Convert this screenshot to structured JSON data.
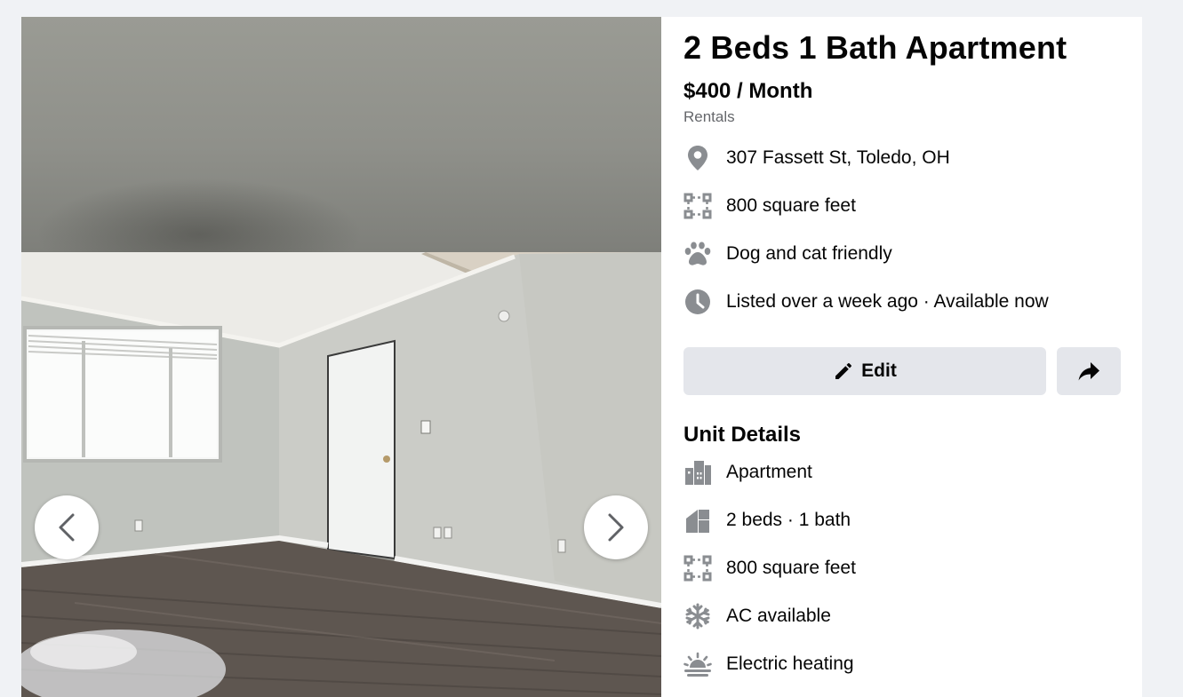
{
  "listing": {
    "title": "2 Beds 1 Bath Apartment",
    "price": "$400 / Month",
    "category": "Rentals"
  },
  "summary": [
    {
      "icon": "location-pin-icon",
      "text": "307 Fassett St, Toledo, OH"
    },
    {
      "icon": "square-footage-icon",
      "text": "800 square feet"
    },
    {
      "icon": "paw-icon",
      "text": "Dog and cat friendly"
    },
    {
      "icon": "clock-icon",
      "text": "Listed over a week ago · Available now"
    }
  ],
  "actions": {
    "edit_label": "Edit",
    "edit_icon": "pencil-icon",
    "share_icon": "share-arrow-icon"
  },
  "unit_details": {
    "title": "Unit Details",
    "items": [
      {
        "icon": "building-icon",
        "text": "Apartment"
      },
      {
        "icon": "house-icon",
        "text": "2 beds · 1 bath"
      },
      {
        "icon": "square-footage-icon",
        "text": "800 square feet"
      },
      {
        "icon": "snowflake-icon",
        "text": "AC available"
      },
      {
        "icon": "sunrise-heating-icon",
        "text": "Electric heating"
      }
    ]
  },
  "gallery": {
    "prev_icon": "chevron-left-icon",
    "next_icon": "chevron-right-icon"
  },
  "colors": {
    "background": "#f0f2f5",
    "button_gray": "#e4e6eb",
    "icon_gray": "#65676b"
  }
}
